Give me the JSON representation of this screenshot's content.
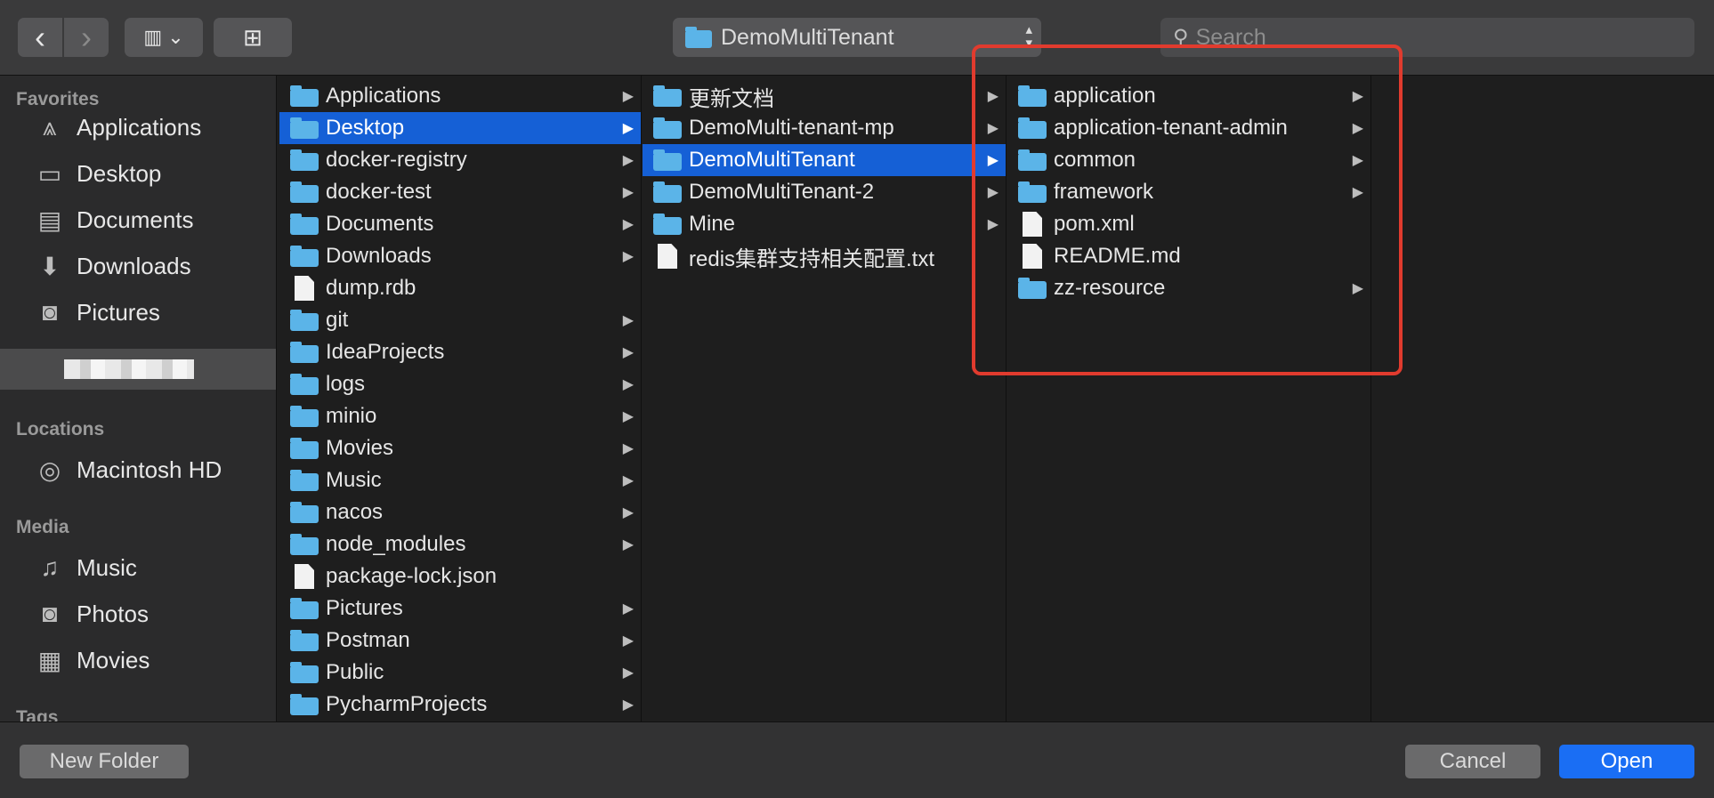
{
  "toolbar": {
    "back_glyph": "‹",
    "forward_glyph": "›",
    "view_glyph": "▥ ⌄",
    "new_folder_glyph": "⊞",
    "path_label": "DemoMultiTenant",
    "search_placeholder": "Search"
  },
  "sidebar": {
    "favorites_label": "Favorites",
    "favorites": [
      {
        "label": "Applications",
        "icon": "apps-icon"
      },
      {
        "label": "Desktop",
        "icon": "desktop-icon"
      },
      {
        "label": "Documents",
        "icon": "documents-icon"
      },
      {
        "label": "Downloads",
        "icon": "downloads-icon"
      },
      {
        "label": "Pictures",
        "icon": "pictures-icon"
      }
    ],
    "locations_label": "Locations",
    "locations": [
      {
        "label": "Macintosh HD",
        "icon": "disk-icon"
      }
    ],
    "media_label": "Media",
    "media": [
      {
        "label": "Music",
        "icon": "music-icon"
      },
      {
        "label": "Photos",
        "icon": "camera-icon"
      },
      {
        "label": "Movies",
        "icon": "film-icon"
      }
    ],
    "tags_label": "Tags"
  },
  "columns": {
    "col1": [
      {
        "label": "Applications",
        "kind": "folder",
        "chevron": true
      },
      {
        "label": "Desktop",
        "kind": "folder",
        "chevron": true,
        "selected": true
      },
      {
        "label": "docker-registry",
        "kind": "folder",
        "chevron": true
      },
      {
        "label": "docker-test",
        "kind": "folder",
        "chevron": true
      },
      {
        "label": "Documents",
        "kind": "folder",
        "chevron": true
      },
      {
        "label": "Downloads",
        "kind": "folder",
        "chevron": true
      },
      {
        "label": "dump.rdb",
        "kind": "file",
        "chevron": false
      },
      {
        "label": "git",
        "kind": "folder",
        "chevron": true
      },
      {
        "label": "IdeaProjects",
        "kind": "folder",
        "chevron": true
      },
      {
        "label": "logs",
        "kind": "folder",
        "chevron": true
      },
      {
        "label": "minio",
        "kind": "folder",
        "chevron": true
      },
      {
        "label": "Movies",
        "kind": "folder",
        "chevron": true
      },
      {
        "label": "Music",
        "kind": "folder",
        "chevron": true
      },
      {
        "label": "nacos",
        "kind": "folder",
        "chevron": true
      },
      {
        "label": "node_modules",
        "kind": "folder",
        "chevron": true
      },
      {
        "label": "package-lock.json",
        "kind": "file",
        "chevron": false
      },
      {
        "label": "Pictures",
        "kind": "folder",
        "chevron": true
      },
      {
        "label": "Postman",
        "kind": "folder",
        "chevron": true
      },
      {
        "label": "Public",
        "kind": "folder",
        "chevron": true
      },
      {
        "label": "PycharmProjects",
        "kind": "folder",
        "chevron": true
      }
    ],
    "col2": [
      {
        "label": "更新文档",
        "kind": "folder",
        "chevron": true
      },
      {
        "label": "DemoMulti-tenant-mp",
        "kind": "folder",
        "chevron": true
      },
      {
        "label": "DemoMultiTenant",
        "kind": "folder",
        "chevron": true,
        "selected": true
      },
      {
        "label": "DemoMultiTenant-2",
        "kind": "folder",
        "chevron": true
      },
      {
        "label": "Mine",
        "kind": "folder",
        "chevron": true
      },
      {
        "label": "redis集群支持相关配置.txt",
        "kind": "file",
        "chevron": false
      }
    ],
    "col3": [
      {
        "label": "application",
        "kind": "folder",
        "chevron": true
      },
      {
        "label": "application-tenant-admin",
        "kind": "folder",
        "chevron": true
      },
      {
        "label": "common",
        "kind": "folder",
        "chevron": true
      },
      {
        "label": "framework",
        "kind": "folder",
        "chevron": true
      },
      {
        "label": "pom.xml",
        "kind": "file",
        "chevron": false
      },
      {
        "label": "README.md",
        "kind": "file",
        "chevron": false
      },
      {
        "label": "zz-resource",
        "kind": "folder",
        "chevron": true
      }
    ]
  },
  "bottom": {
    "new_folder_label": "New Folder",
    "cancel_label": "Cancel",
    "open_label": "Open"
  },
  "colors": {
    "selection": "#1560d6",
    "folder": "#5bb4e8",
    "highlight_box": "#e13b2e",
    "open_button": "#1a6ef4"
  }
}
